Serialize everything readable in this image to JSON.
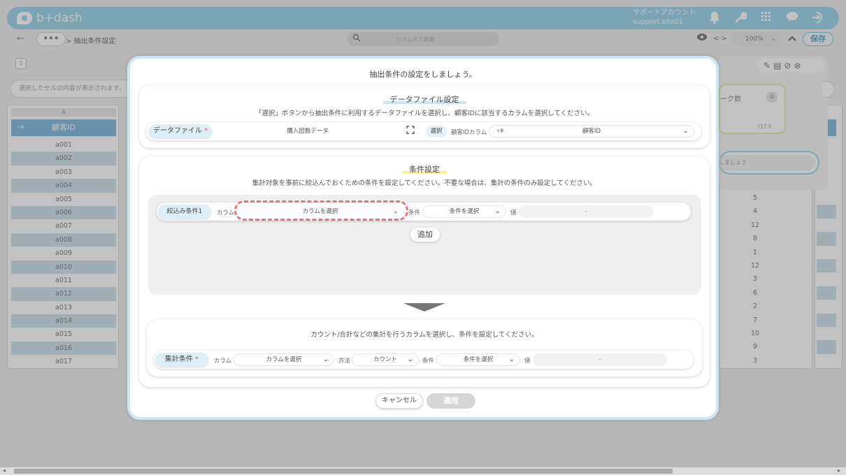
{
  "header": {
    "logo_text": "b+dash",
    "account_name": "サポートアカウント",
    "account_site": "support.site01",
    "icons": [
      "bell-icon",
      "wrench-icon",
      "grid-icon",
      "chat-icon",
      "logout-icon"
    ]
  },
  "toolbar": {
    "back_label": "←",
    "more_label": "•••",
    "breadcrumb": "> 抽出条件設定",
    "search_placeholder": "カラム名で検索",
    "zoom": "100%",
    "save_label": "保存"
  },
  "sheet": {
    "page_number": "1",
    "cell_info_placeholder": "選択したセルの内容が表示されます。",
    "column_letter": "A",
    "column_header": "顧客ID",
    "column_tag": "+あ",
    "rows": [
      "a001",
      "a002",
      "a003",
      "a004",
      "a005",
      "a006",
      "a007",
      "a008",
      "a009",
      "a010",
      "a011",
      "a012",
      "a013",
      "a014",
      "a015",
      "a016",
      "a017"
    ],
    "right_values": [
      "5",
      "4",
      "12",
      "8",
      "1",
      "12",
      "3",
      "6",
      "2",
      "7",
      "10",
      "9",
      "3"
    ],
    "kpi_label": "ーク数",
    "kpi_unit": "/17人",
    "lets_text": "しましょう"
  },
  "modal": {
    "title": "抽出条件の設定をしましょう。",
    "data_file": {
      "section_title": "データファイル設定",
      "description": "「選択」ボタンから抽出条件に利用するデータファイルを選択し、顧客IDに該当するカラムを選択してください。",
      "label": "データファイル",
      "required_mark": "*",
      "file_value": "購入回数データ",
      "select_button": "選択",
      "customer_id_label": "顧客IDカラム",
      "customer_id_tag": "+あ",
      "customer_id_value": "顧客ID"
    },
    "conditions": {
      "section_title": "条件設定",
      "description": "集計対象を事前に絞込んでおくための条件を設定してください。不要な場合は、集計の条件のみ設定してください。",
      "filter_label": "絞込み条件1",
      "column_label": "カラム",
      "column_value": "カラムを選択",
      "condition_label": "条件",
      "condition_value": "条件を選択",
      "value_label": "値",
      "value_placeholder": "-",
      "add_button": "追加"
    },
    "aggregate": {
      "description": "カウント/合計などの集計を行うカラムを選択し、条件を設定してください。",
      "label": "集計条件",
      "required_mark": "*",
      "column_label": "カラム",
      "column_value": "カラムを選択",
      "method_label": "方法",
      "method_value": "カウント",
      "condition_label": "条件",
      "condition_value": "条件を選択",
      "value_label": "値",
      "value_placeholder": "-"
    },
    "cancel_button": "キャンセル",
    "apply_button": "適用"
  }
}
